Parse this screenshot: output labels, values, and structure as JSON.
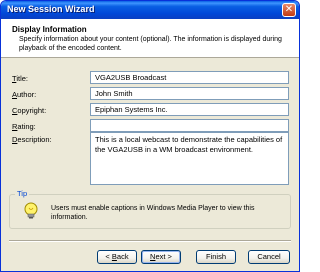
{
  "window": {
    "title": "New Session Wizard",
    "close_glyph": "✕",
    "icon": "close-icon"
  },
  "header": {
    "title": "Display Information",
    "subtitle": "Specify information about your content (optional). The information is displayed during playback of the encoded content."
  },
  "fields": {
    "title": {
      "label_key": "T",
      "label_rest": "itle:",
      "value": "VGA2USB Broadcast"
    },
    "author": {
      "label_key": "A",
      "label_rest": "uthor:",
      "value": "John Smith"
    },
    "copyright": {
      "label_key": "C",
      "label_rest": "opyright:",
      "value": "Epiphan Systems Inc."
    },
    "rating": {
      "label_key": "R",
      "label_rest": "ating:",
      "value": ""
    },
    "description": {
      "label_key": "D",
      "label_rest": "escription:",
      "value": "This is a local webcast to demonstrate the capabilities of the VGA2USB in a WM broadcast environment."
    }
  },
  "tip": {
    "legend": "Tip",
    "text": "Users must enable captions in Windows Media Player to view this information.",
    "icon": "lightbulb-icon"
  },
  "buttons": {
    "back": {
      "prefix": "< ",
      "key": "B",
      "rest": "ack"
    },
    "next": {
      "prefix": "",
      "key": "N",
      "rest": "ext >"
    },
    "finish": {
      "label": "Finish"
    },
    "cancel": {
      "label": "Cancel"
    }
  },
  "colors": {
    "titlebar": "#0a5fe3",
    "dialog_bg": "#ece9d8",
    "tip_legend": "#0046d5",
    "input_border": "#7f9db9"
  }
}
